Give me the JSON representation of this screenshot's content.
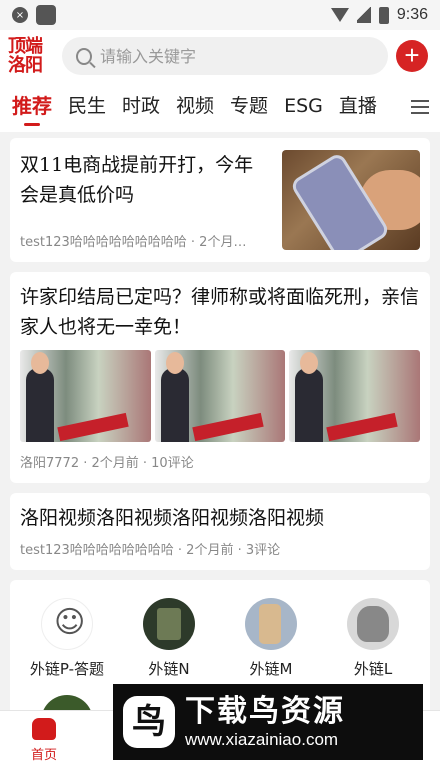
{
  "status_bar": {
    "time": "9:36"
  },
  "header": {
    "logo_line1": "顶端",
    "logo_line2": "洛阳",
    "search_placeholder": "请输入关键字",
    "add_label": "+"
  },
  "tabs": [
    "推荐",
    "民生",
    "时政",
    "视频",
    "专题",
    "ESG",
    "直播"
  ],
  "feed": [
    {
      "title": "双11电商战提前开打，今年会是真低价吗",
      "meta": "test123哈哈哈哈哈哈哈哈哈 · 2个月…"
    },
    {
      "title": "许家印结局已定吗？律师称或将面临死刑，亲信家人也将无一幸免！",
      "meta": "洛阳7772 · 2个月前 · 10评论"
    },
    {
      "title": "洛阳视频洛阳视频洛阳视频洛阳视频",
      "meta": "test123哈哈哈哈哈哈哈哈 · 2个月前 · 3评论"
    }
  ],
  "links": [
    {
      "label": "外链P-答题",
      "icon": "cartoon-avatar"
    },
    {
      "label": "外链N",
      "icon": "phone-avatar"
    },
    {
      "label": "外链M",
      "icon": "phone-avatar"
    },
    {
      "label": "外链L",
      "icon": "cartoon-avatar"
    }
  ],
  "bottom_nav": {
    "home": "首页"
  },
  "watermark": {
    "logo_char": "鸟",
    "title": "下载鸟资源",
    "url": "www.xiazainiao.com"
  }
}
